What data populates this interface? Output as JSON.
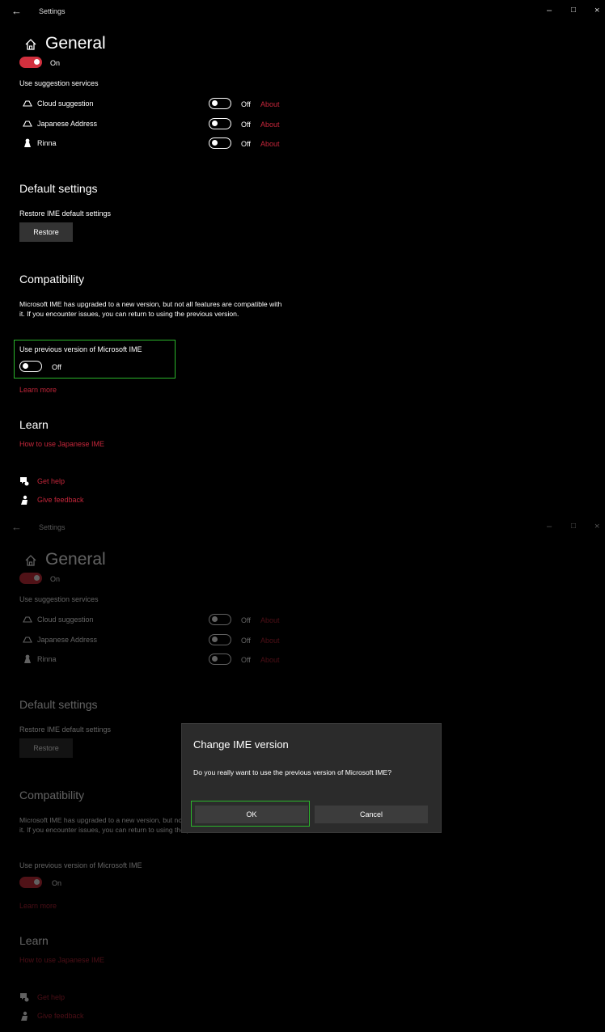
{
  "window": {
    "back_glyph": "←",
    "title": "Settings",
    "minimize_glyph": "–",
    "maximize_glyph": "□",
    "close_glyph": "×"
  },
  "page": {
    "title": "General",
    "home_icon": "home-icon"
  },
  "top_toggle": {
    "state_label": "On"
  },
  "suggestions": {
    "heading": "Use suggestion services",
    "items": [
      {
        "label": "Cloud suggestion",
        "icon": "cloud-icon",
        "state_label": "Off",
        "link": "About"
      },
      {
        "label": "Japanese Address",
        "icon": "cloud-icon",
        "state_label": "Off",
        "link": "About"
      },
      {
        "label": "Rinna",
        "icon": "rinna-icon",
        "state_label": "Off",
        "link": "About"
      }
    ]
  },
  "default_settings": {
    "heading": "Default settings",
    "restore_label": "Restore IME default settings",
    "restore_button": "Restore"
  },
  "compatibility": {
    "heading": "Compatibility",
    "description": "Microsoft IME has upgraded to a new version, but not all features are compatible with it. If you encounter issues, you can return to using the previous version.",
    "toggle_label": "Use previous version of Microsoft IME",
    "state_before": "Off",
    "state_after": "On",
    "learn_more": "Learn more"
  },
  "learn": {
    "heading": "Learn",
    "link": "How to use Japanese IME"
  },
  "help": {
    "get_help": "Get help",
    "give_feedback": "Give feedback"
  },
  "dialog": {
    "title": "Change IME version",
    "message": "Do you really want to use the previous version of Microsoft IME?",
    "ok": "OK",
    "cancel": "Cancel"
  },
  "colors": {
    "accent": "#d1303e",
    "link": "#c4263a",
    "highlight": "#2bb52b",
    "background": "#000000"
  }
}
